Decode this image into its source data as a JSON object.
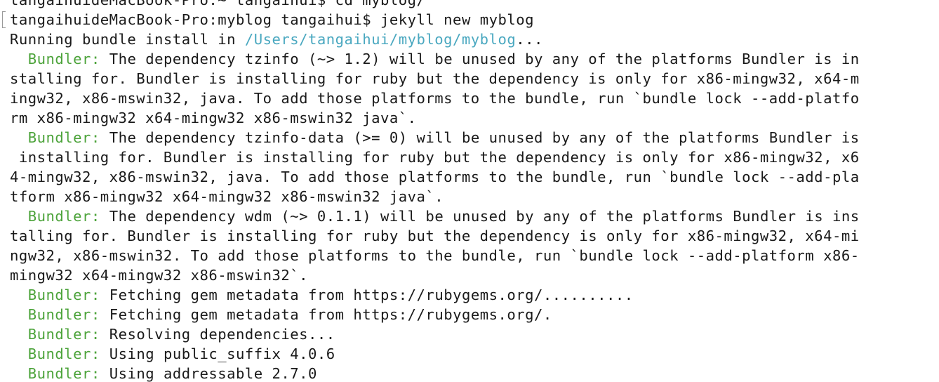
{
  "colors": {
    "background": "#ffffff",
    "text": "#1a1a1a",
    "path": "#4aa8c0",
    "bundler_tag": "#4ca33a"
  },
  "terminal": {
    "previous_command": "tangaihuideMacBook-Pro:~ tangaihui$ cd myblog/",
    "prompt": "tangaihuideMacBook-Pro:myblog tangaihui$ ",
    "command": "jekyll new myblog",
    "running_prefix": "Running bundle install in ",
    "running_path": "/Users/tangaihui/myblog/myblog",
    "running_suffix": "...",
    "bundler_tag": "Bundler:",
    "messages": [
      {
        "first": "The dependency tzinfo (~> 1.2) will be unused by any of the platforms Bundler is in",
        "rest": [
          "stalling for. Bundler is installing for ruby but the dependency is only for x86-mingw32, x64-m",
          "ingw32, x86-mswin32, java. To add those platforms to the bundle, run `bundle lock --add-platfo",
          "rm x86-mingw32 x64-mingw32 x86-mswin32 java`."
        ]
      },
      {
        "first": "The dependency tzinfo-data (>= 0) will be unused by any of the platforms Bundler is",
        "rest": [
          " installing for. Bundler is installing for ruby but the dependency is only for x86-mingw32, x6",
          "4-mingw32, x86-mswin32, java. To add those platforms to the bundle, run `bundle lock --add-pla",
          "tform x86-mingw32 x64-mingw32 x86-mswin32 java`."
        ]
      },
      {
        "first": "The dependency wdm (~> 0.1.1) will be unused by any of the platforms Bundler is ins",
        "rest": [
          "talling for. Bundler is installing for ruby but the dependency is only for x86-mingw32, x64-mi",
          "ngw32, x86-mswin32. To add those platforms to the bundle, run `bundle lock --add-platform x86-",
          "mingw32 x64-mingw32 x86-mswin32`."
        ]
      },
      {
        "first": "Fetching gem metadata from https://rubygems.org/..........",
        "rest": []
      },
      {
        "first": "Fetching gem metadata from https://rubygems.org/.",
        "rest": []
      },
      {
        "first": "Resolving dependencies...",
        "rest": []
      },
      {
        "first": "Using public_suffix 4.0.6",
        "rest": []
      },
      {
        "first": "Using addressable 2.7.0",
        "rest": []
      }
    ]
  }
}
